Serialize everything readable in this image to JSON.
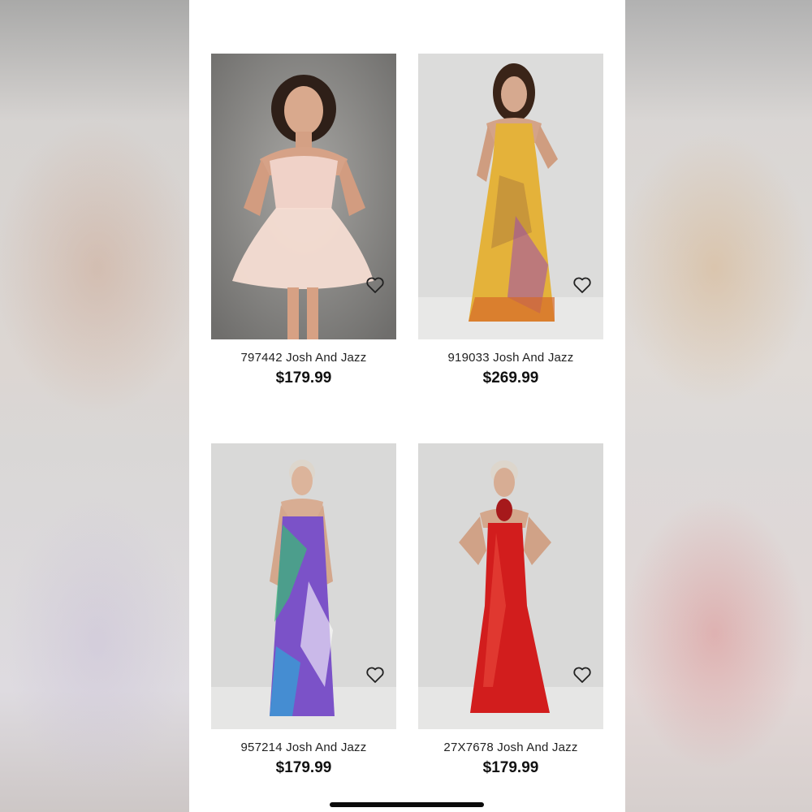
{
  "products": [
    {
      "title": "797442 Josh And Jazz",
      "price": "$179.99",
      "image": "pink-strapless-short-dress-photo",
      "bg": "#8d8c8a",
      "dress_color": "#f3d6cf",
      "favorite_icon": "heart-outline-icon"
    },
    {
      "title": "919033 Josh And Jazz",
      "price": "$269.99",
      "image": "leopard-print-halter-gown-photo",
      "bg": "#dededd",
      "dress_color": "#e3b23c",
      "favorite_icon": "heart-outline-icon"
    },
    {
      "title": "957214 Josh And Jazz",
      "price": "$179.99",
      "image": "purple-floral-strapless-gown-photo",
      "bg": "#dcdcdb",
      "dress_color": "#7b4fc9",
      "favorite_icon": "heart-outline-icon"
    },
    {
      "title": "27X7678 Josh And Jazz",
      "price": "$179.99",
      "image": "red-mermaid-gown-photo",
      "bg": "#dcdcdb",
      "dress_color": "#d21d1d",
      "favorite_icon": "heart-outline-icon"
    }
  ]
}
